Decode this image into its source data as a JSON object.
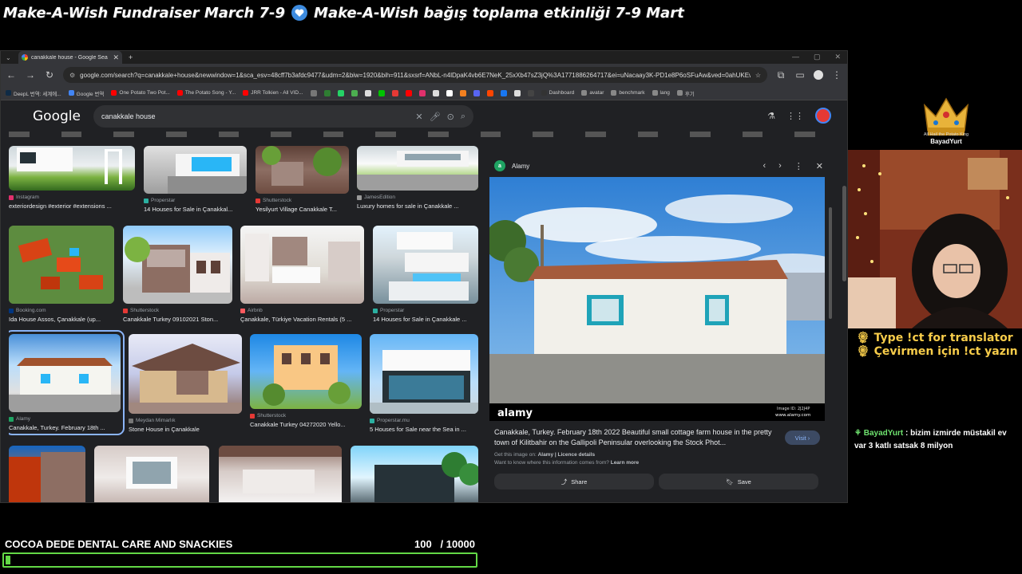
{
  "stream": {
    "banner_en": "Make-A-Wish Fundraiser March 7-9",
    "banner_tr": "Make-A-Wish bağış toplama etkinliği 7-9 Mart",
    "crown_caption": "All Hail the Potato King",
    "crown_name": "BayadYurt",
    "translator_line_1": "Type !ct for translator",
    "translator_line_2": "Çevirmen için !ct yazın",
    "chat": {
      "user": "BayadYurt",
      "message": ": bizim izmirde müstakil ev var 3 katlı satsak 8 milyon"
    },
    "goal": {
      "title": "COCOA DEDE DENTAL CARE AND SNACKIES",
      "current": "100",
      "target": "/ 10000",
      "progress_fraction": 0.01
    }
  },
  "browser": {
    "tab_title": "canakkale house - Google Sea",
    "url": "google.com/search?q=canakkale+house&newwindow=1&sca_esv=48cff7b3afdc9477&udm=2&biw=1920&bih=911&sxsrf=ANbL-n4lDpaK4vb6E7NeK_25xXb47sZ3jQ%3A1771886264717&ei=uNacaay3K-PD1e8P6oSFuAw&ved=0ahUKEwis84_b1vCSAxXjY...",
    "bookmarks": [
      {
        "label": "DeepL 번역: 세계에...",
        "color": "#0f2b46"
      },
      {
        "label": "Google 번역",
        "color": "#4285f4"
      },
      {
        "label": "One Potato Two Pot...",
        "color": "#ff0000"
      },
      {
        "label": "The Potato Song - Y...",
        "color": "#ff0000"
      },
      {
        "label": "JRR Tolkien - All VID...",
        "color": "#ff0000"
      }
    ],
    "bookmark_icons": [
      "#777",
      "#2e7d32",
      "#25d366",
      "#4caf50",
      "#ddd",
      "#00c300",
      "#e53935",
      "#ff0000",
      "#e1306c",
      "#ddd",
      "#fff",
      "#f48120",
      "#5865f2",
      "#ff4500",
      "#1877f2",
      "#ddd",
      "#444"
    ],
    "bookmarks_right": [
      {
        "label": "Dashboard",
        "color": "#333"
      },
      {
        "label": "avatar",
        "color": "#888"
      },
      {
        "label": "benchmark",
        "color": "#888"
      },
      {
        "label": "lang",
        "color": "#888"
      },
      {
        "label": "후기",
        "color": "#888"
      }
    ],
    "search_query": "canakkale house"
  },
  "results": {
    "row1": [
      {
        "source": "Instagram",
        "title": "exteriordesign #exterior #extensions ...",
        "src_color": "#e1306c"
      },
      {
        "source": "Properstar",
        "title": "14 Houses for Sale in Çanakkal...",
        "src_color": "#2bb0a1"
      },
      {
        "source": "Shutterstock",
        "title": "Yesilyurt Village Canakkale T...",
        "src_color": "#e53935"
      },
      {
        "source": "JamesEdition",
        "title": "Luxury homes for sale in Çanakkale ...",
        "src_color": "#999"
      }
    ],
    "row2": [
      {
        "source": "Booking.com",
        "title": "Ida House Assos, Çanakkale (up...",
        "src_color": "#003580"
      },
      {
        "source": "Shutterstock",
        "title": "Canakkale Turkey 09102021 Ston...",
        "src_color": "#e53935"
      },
      {
        "source": "Airbnb",
        "title": "Çanakkale, Türkiye Vacation Rentals (5 ...",
        "src_color": "#ff5a5f"
      },
      {
        "source": "Properstar",
        "title": "14 Houses for Sale in Çanakkale ...",
        "src_color": "#2bb0a1"
      }
    ],
    "row3": [
      {
        "source": "Alamy",
        "title": "Canakkale, Turkey. February 18th ...",
        "src_color": "#1fa463"
      },
      {
        "source": "Meydan Mimarlık",
        "title": "Stone House in Çanakkale",
        "src_color": "#777"
      },
      {
        "source": "Shutterstock",
        "title": "Canakkale Turkey 04272020 Yello...",
        "src_color": "#e53935"
      },
      {
        "source": "Properstar.mu",
        "title": "5 Houses for Sale near the Sea in ...",
        "src_color": "#2bb0a1"
      }
    ]
  },
  "preview": {
    "site": "Alamy",
    "caption": "Canakkale, Turkey. February 18th 2022 Beautiful small cottage farm house in the pretty town of Kilitbahir on the Gallipoli Peninsular overlooking the Stock Phot...",
    "visit": "Visit",
    "get_image": "Get this image on:",
    "get_image_site": "Alamy",
    "licence": "| Licence details",
    "want_know": "Want to know where this information comes from?",
    "learn_more": "Learn more",
    "share": "Share",
    "save": "Save",
    "watermark": "alamy",
    "image_id": "Image ID: 2J2J4P",
    "image_url": "www.alamy.com"
  }
}
